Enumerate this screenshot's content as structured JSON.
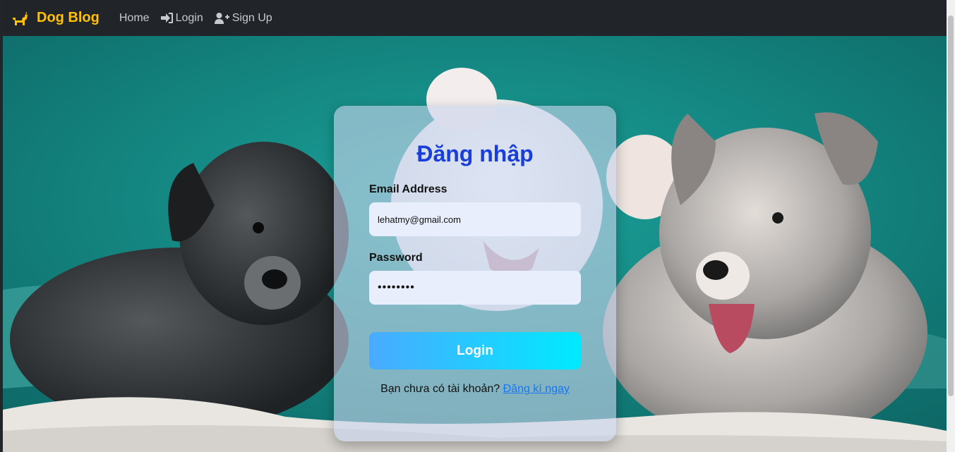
{
  "navbar": {
    "brand": "Dog Blog",
    "brand_icon": "dog-icon",
    "brand_color": "#ffc107",
    "links": [
      {
        "label": "Home",
        "icon": null
      },
      {
        "label": "Login",
        "icon": "sign-in-icon"
      },
      {
        "label": "Sign Up",
        "icon": "user-plus-icon"
      }
    ]
  },
  "login_form": {
    "title": "Đăng nhập",
    "email_label": "Email Address",
    "email_value": "lehatmy@gmail.com",
    "password_label": "Password",
    "password_value": "••••••••",
    "submit_label": "Login",
    "signup_prompt": "Bạn chưa có tài khoản?",
    "signup_link": "Đăng kí ngay"
  },
  "colors": {
    "title": "#1a3fd8",
    "button_gradient_start": "#4aaaff",
    "button_gradient_end": "#00eaff",
    "link": "#1976f0"
  }
}
